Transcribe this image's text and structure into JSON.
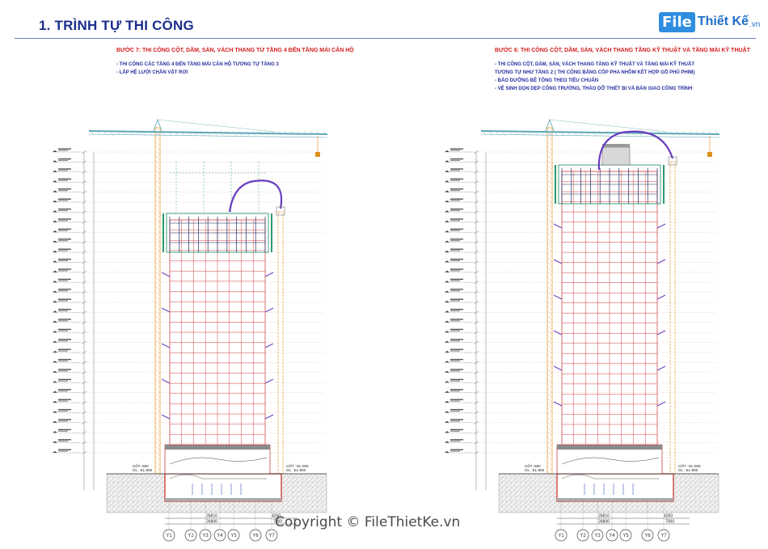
{
  "header": {
    "title": "1. TRÌNH TỰ THI CÔNG",
    "logo_file": "File",
    "logo_rest": "Thiết Kế",
    "logo_tld": ".vn"
  },
  "panels": [
    {
      "heading": "BƯỚC 7: THI CÔNG CỘT, DẦM, SÀN, VÁCH THANG TỪ TẦNG 4 ĐẾN TẦNG MÁI CĂN HỘ",
      "notes": [
        "- THI CÔNG CÁC TẦNG 4 ĐẾN TẦNG MÁI CĂN HỘ TƯƠNG TỰ TẦNG 3",
        "- LẮP HỆ LƯỚI CHẮN VẬT RƠI"
      ],
      "left_elev_label": "CỐT -800\nOL : EL-800",
      "right_elev_label": "CỐT : EL-800\nOL : EL-800",
      "dims": [
        "26810",
        "26800",
        "4250",
        "7000"
      ],
      "grid_labels": [
        "Y1",
        "Y2",
        "Y3",
        "Y4",
        "Y5",
        "Y6",
        "Y7"
      ]
    },
    {
      "heading": "BƯỚC 6: THI CÔNG CỘT, DẦM, SÀN, VÁCH THANG TẦNG KỸ THUẬT VÀ TẦNG MÁI KỸ THUẬT",
      "notes": [
        "- THI CÔNG CỘT, DẦM, SÀN, VÁCH THANG TẦNG KỸ THUẬT VÀ TẦNG MÁI KỸ THUẬT",
        "  TƯƠNG TỰ NHƯ TẦNG 2 ( THI CÔNG BẰNG CỐP PHA NHÔM KẾT HỢP GỖ PHỦ PHIM)",
        "- BẢO DƯỠNG BÊ TÔNG THEO TIÊU CHUẨN",
        "- VỆ SINH DỌN DẸP CÔNG TRƯỜNG, THÁO DỠ THIẾT BỊ VÀ BÀN GIAO CÔNG TRÌNH"
      ],
      "left_elev_label": "CỐT -800\nOL : EL-800",
      "right_elev_label": "CỐT : EL-800\nOL : EL-800",
      "dims": [
        "26810",
        "26800",
        "4250",
        "7000"
      ],
      "grid_labels": [
        "Y1",
        "Y2",
        "Y3",
        "Y4",
        "Y5",
        "Y6",
        "Y7"
      ]
    }
  ],
  "watermark": "Copyright © FileThietKe.vn",
  "colors": {
    "title": "#1a2f8c",
    "heading": "#d42020",
    "notes": "#2a2fa0",
    "crane": "#5fa6b5",
    "formwork": "#2a9a70",
    "pump": "#6a3fc0",
    "frame": "#d44a4a"
  }
}
